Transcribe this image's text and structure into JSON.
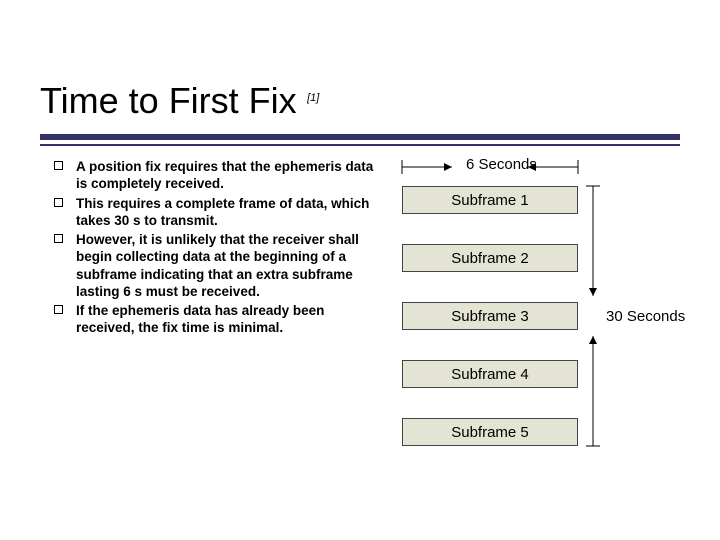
{
  "title": "Time to First Fix",
  "reference_mark": "[1]",
  "bullets": [
    "A position fix requires that the ephemeris data is completely received.",
    "This requires a complete frame of data, which takes 30 s to transmit.",
    "However, it is unlikely that the receiver shall begin collecting data at the beginning of a subframe indicating that an extra subframe lasting 6 s must be received.",
    "If the ephemeris data has already been received, the fix time is minimal."
  ],
  "diagram": {
    "top_label": "6 Seconds",
    "side_label": "30 Seconds",
    "subframes": [
      "Subframe 1",
      "Subframe 2",
      "Subframe 3",
      "Subframe 4",
      "Subframe 5"
    ]
  },
  "colors": {
    "rule": "#333366",
    "box_fill": "#e4e4d4"
  }
}
